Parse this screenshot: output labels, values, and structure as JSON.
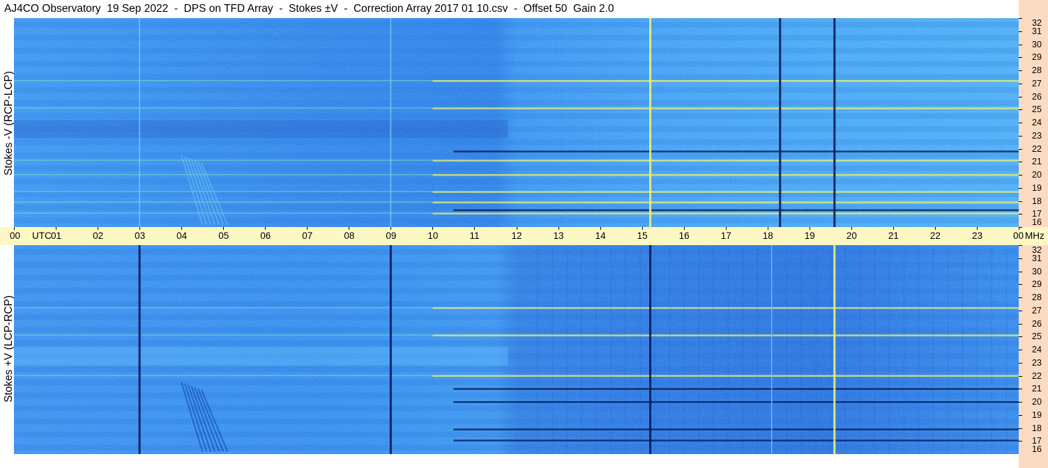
{
  "title": "AJ4CO Observatory  19 Sep 2022  -  DPS on TFD Array  -  Stokes ±V  -  Correction Array 2017 01 10.csv  -  Offset 50  Gain 2.0",
  "colors": {
    "background_low": "#0a4fd6",
    "background_high": "#46b6f6",
    "time_axis_bg": "#fdf8c3",
    "freq_axis_bg": "#fbdcc3",
    "dark_band": "#061a55",
    "hot_band": "#f2f26a"
  },
  "chart_data": {
    "type": "heatmap",
    "description_units": "time in UTC hours, frequency in MHz",
    "x_ticks": [
      "00",
      "01",
      "02",
      "03",
      "04",
      "05",
      "06",
      "07",
      "08",
      "09",
      "10",
      "11",
      "12",
      "13",
      "14",
      "15",
      "16",
      "17",
      "18",
      "19",
      "20",
      "21",
      "22",
      "23",
      "00"
    ],
    "x_unit": "UTC",
    "xlim": [
      0,
      24
    ],
    "y_ticks": [
      "16",
      "17",
      "18",
      "19",
      "20",
      "21",
      "22",
      "23",
      "24",
      "25",
      "26",
      "27",
      "28",
      "29",
      "30",
      "31",
      "32"
    ],
    "y_unit": "MHz",
    "ylim": [
      16,
      32
    ],
    "panels": [
      {
        "ylabel": "Stokes -V (RCP-LCP)",
        "polarity": "minus",
        "vertical_lines_utc": [
          3.0,
          9.0,
          15.2,
          18.3,
          19.6
        ],
        "vertical_line_style": [
          "light",
          "light",
          "bright",
          "dark",
          "dark"
        ],
        "bright_freq_bands_mhz": [
          17.05,
          17.9,
          18.7,
          20.0,
          21.1,
          25.1,
          27.2
        ],
        "dark_freq_bands_mhz": [
          17.3,
          21.8
        ],
        "burst_window_utc": [
          4.0,
          5.1
        ]
      },
      {
        "ylabel": "Stokes +V (LCP-RCP)",
        "polarity": "plus",
        "vertical_lines_utc": [
          3.0,
          9.0,
          15.2,
          18.1,
          19.6
        ],
        "vertical_line_style": [
          "dark",
          "dark",
          "dark",
          "light",
          "bright"
        ],
        "bright_freq_bands_mhz": [
          22.0,
          25.1,
          27.2
        ],
        "dark_freq_bands_mhz": [
          17.05,
          17.9,
          20.0,
          21.0
        ],
        "burst_window_utc": [
          4.0,
          5.1
        ]
      }
    ]
  }
}
